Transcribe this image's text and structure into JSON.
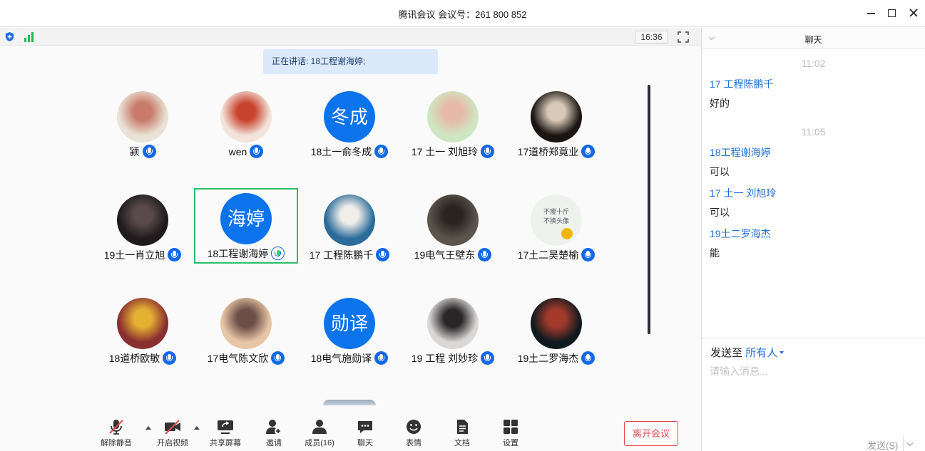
{
  "window": {
    "title": "腾讯会议 会议号：261 800 852"
  },
  "statusbar": {
    "time": "16:36"
  },
  "speaker_banner": "正在讲话: 18工程谢海婷;",
  "participants": [
    {
      "name": "颍",
      "avatar": "photo",
      "avatar_colors": [
        "#e8e3d6",
        "#c97a6a"
      ],
      "speaking": false
    },
    {
      "name": "wen",
      "avatar": "photo",
      "avatar_colors": [
        "#f3e3da",
        "#c8432e"
      ],
      "speaking": false
    },
    {
      "name": "18土一俞冬成",
      "avatar": "text",
      "avatar_text": "冬成",
      "speaking": false
    },
    {
      "name": "17  土一 刘旭玲",
      "avatar": "photo",
      "avatar_colors": [
        "#cfe6c2",
        "#e6b9a8"
      ],
      "speaking": false
    },
    {
      "name": "17道桥郑竟业",
      "avatar": "photo",
      "avatar_colors": [
        "#1a1412",
        "#d8c9b8"
      ],
      "speaking": false
    },
    {
      "name": "19土一肖立旭",
      "avatar": "photo",
      "avatar_colors": [
        "#1f1a1c",
        "#5a4a4c"
      ],
      "speaking": false
    },
    {
      "name": "18工程谢海婷",
      "avatar": "text",
      "avatar_text": "海婷",
      "speaking": true
    },
    {
      "name": "17  工程陈鹏千",
      "avatar": "photo",
      "avatar_colors": [
        "#2b6c9a",
        "#f1ede8"
      ],
      "speaking": false
    },
    {
      "name": "19电气王壁东",
      "avatar": "photo",
      "avatar_colors": [
        "#5c544c",
        "#2a2420"
      ],
      "speaking": false
    },
    {
      "name": "17土二吴楚榆",
      "avatar": "textimg",
      "avatar_lines": [
        "不瘦十斤",
        "不换头像"
      ],
      "speaking": false
    },
    {
      "name": "18道桥欧敏",
      "avatar": "photo",
      "avatar_colors": [
        "#8a2f30",
        "#e5b133"
      ],
      "speaking": false
    },
    {
      "name": "17电气陈文欣",
      "avatar": "photo",
      "avatar_colors": [
        "#e7c6a6",
        "#6b4e47"
      ],
      "speaking": false
    },
    {
      "name": "18电气施勋译",
      "avatar": "text",
      "avatar_text": "勋译",
      "speaking": false
    },
    {
      "name": "19 工程 刘妙珍",
      "avatar": "photo",
      "avatar_colors": [
        "#d9d8d6",
        "#2a2628"
      ],
      "speaking": false
    },
    {
      "name": "19土二罗海杰",
      "avatar": "photo",
      "avatar_colors": [
        "#0f1a1f",
        "#a33a2c"
      ],
      "speaking": false
    }
  ],
  "toolbar": {
    "mute": "解除静音",
    "video": "开启视频",
    "share": "共享屏幕",
    "invite": "邀请",
    "members": "成员(16)",
    "chat": "聊天",
    "emoji": "表情",
    "docs": "文档",
    "settings": "设置",
    "leave": "离开会议"
  },
  "chat": {
    "title": "聊天",
    "messages": [
      {
        "time": "11:02"
      },
      {
        "sender": "17  工程陈鹏千",
        "text": "好的"
      },
      {
        "time": "11:05"
      },
      {
        "sender": "18工程谢海婷",
        "text": "可以"
      },
      {
        "sender": "17  土一 刘旭玲",
        "text": "可以"
      },
      {
        "sender": "19土二罗海杰",
        "text": "能"
      }
    ],
    "send_to_label": "发送至",
    "send_to_target": "所有人",
    "input_placeholder": "请输入消息...",
    "send_button": "发送(S)"
  },
  "colors": {
    "accent": "#0b73ec",
    "speaking_border": "#2bbf68",
    "leave": "#e5484d",
    "link": "#1e6fd9"
  }
}
